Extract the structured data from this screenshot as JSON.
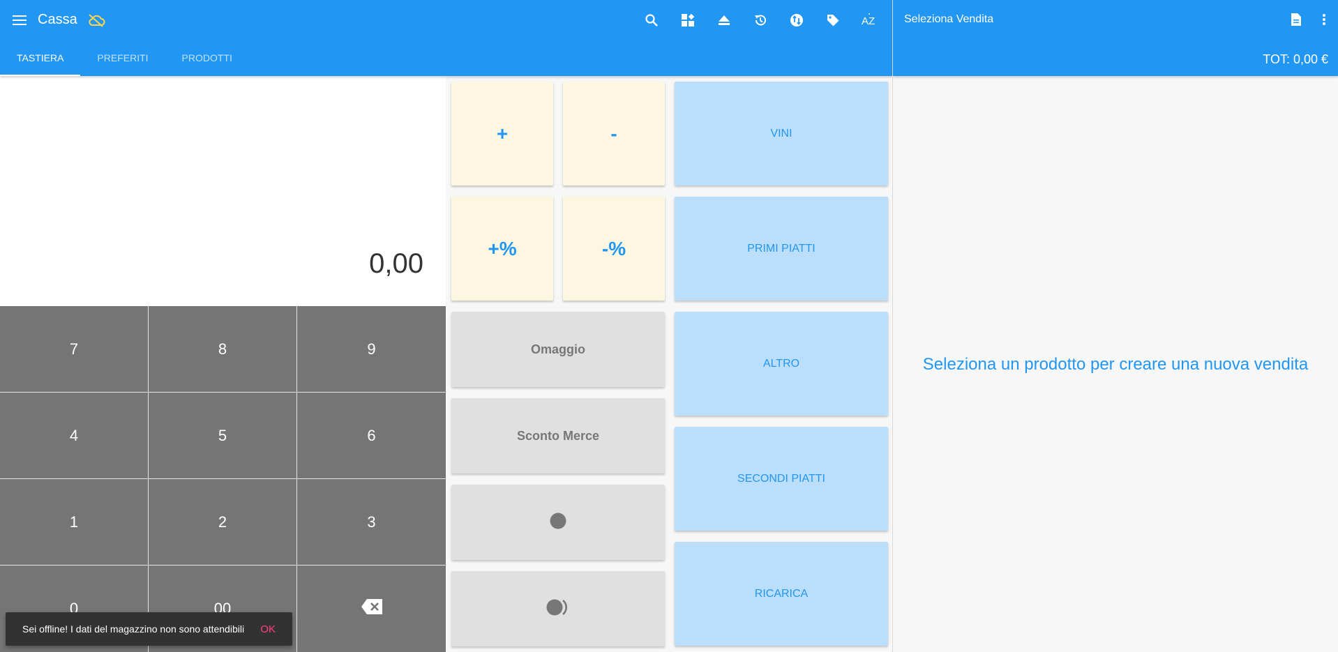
{
  "header": {
    "title": "Cassa",
    "tabs": [
      {
        "label": "TASTIERA"
      },
      {
        "label": "PREFERITI"
      },
      {
        "label": "PRODOTTI"
      }
    ],
    "toolbar_icons": [
      "search-icon",
      "dashboard-icon",
      "eject-icon",
      "history-icon",
      "exchange-icon",
      "tag-icon",
      "sort-az-icon"
    ],
    "sort_label": "AZ"
  },
  "display": {
    "value": "0,00"
  },
  "keypad": {
    "keys": [
      "7",
      "8",
      "9",
      "4",
      "5",
      "6",
      "1",
      "2",
      "3",
      "0",
      "00"
    ]
  },
  "operations": {
    "plus": "+",
    "minus": "-",
    "plus_percent": "+%",
    "minus_percent": "-%",
    "omaggio": "Omaggio",
    "sconto_merce": "Sconto Merce"
  },
  "categories": [
    "VINI",
    "PRIMI PIATTI",
    "ALTRO",
    "SECONDI PIATTI",
    "RICARICA"
  ],
  "sale_panel": {
    "title": "Seleziona Vendita",
    "total": "TOT: 0,00 €",
    "empty_message": "Seleziona un prodotto per creare una nuova vendita"
  },
  "snackbar": {
    "message": "Sei offline! I dati del magazzino non sono attendibili",
    "action": "OK"
  },
  "colors": {
    "primary": "#2196f3",
    "keypad": "#757575",
    "operation_tile": "#fdf7e1",
    "category_tile": "#bbdefb",
    "snackbar_action": "#ff4081"
  }
}
